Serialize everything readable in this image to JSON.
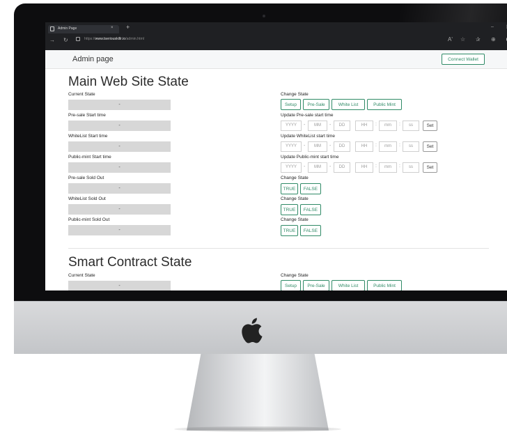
{
  "browser": {
    "tab_title": "Admin Page",
    "tab_close": "×",
    "new_tab": "+",
    "url_prefix": "https://",
    "url_host": "www.tseriouskillr.io",
    "url_path": "/admin.html",
    "minimize": "–",
    "restore": "❐"
  },
  "header": {
    "brand": "Admin page",
    "connect_label": "Connect Wallet"
  },
  "main_section": {
    "title": "Main Web Site State",
    "current_state": {
      "label": "Current State",
      "value": "-"
    },
    "change_state": {
      "label": "Change State",
      "buttons": [
        "Setup",
        "Pre-Sale",
        "White List",
        "Public Mint"
      ]
    },
    "presale_start": {
      "label": "Pre-sale Start time",
      "value": "-"
    },
    "presale_update": {
      "label": "Update Pre-sale start time"
    },
    "whitelist_start": {
      "label": "WhiteList Start time",
      "value": "-"
    },
    "whitelist_update": {
      "label": "Update WhiteList start time"
    },
    "publicmint_start": {
      "label": "Public-mint Start time",
      "value": "-"
    },
    "publicmint_update": {
      "label": "Update Public-mint start time"
    },
    "presale_soldout": {
      "label": "Pre-sale Sold Out",
      "value": "-"
    },
    "whitelist_soldout": {
      "label": "WhiteList Sold Out",
      "value": "-"
    },
    "publicmint_soldout": {
      "label": "Public-mint Sold Out",
      "value": "-"
    },
    "soldout_change_label": "Change State",
    "true_label": "TRUE",
    "false_label": "FALSE"
  },
  "datetime_placeholders": {
    "year": "YYYY",
    "month": "MM",
    "day": "DD",
    "hour": "HH",
    "minute": "mm",
    "second": "ss",
    "dash": "-",
    "colon": ":",
    "set_label": "Set"
  },
  "contract_section": {
    "title": "Smart Contract State",
    "current_state": {
      "label": "Current State",
      "value": "-"
    },
    "change_state": {
      "label": "Change State",
      "buttons": [
        "Setup",
        "Pre-Sale",
        "White List",
        "Public Mint"
      ]
    }
  },
  "colors": {
    "accent": "#2f8a66",
    "readonly_bg": "#d7d7d7",
    "bezel": "#0d0d0f",
    "chrome_bar": "#1f2023"
  }
}
